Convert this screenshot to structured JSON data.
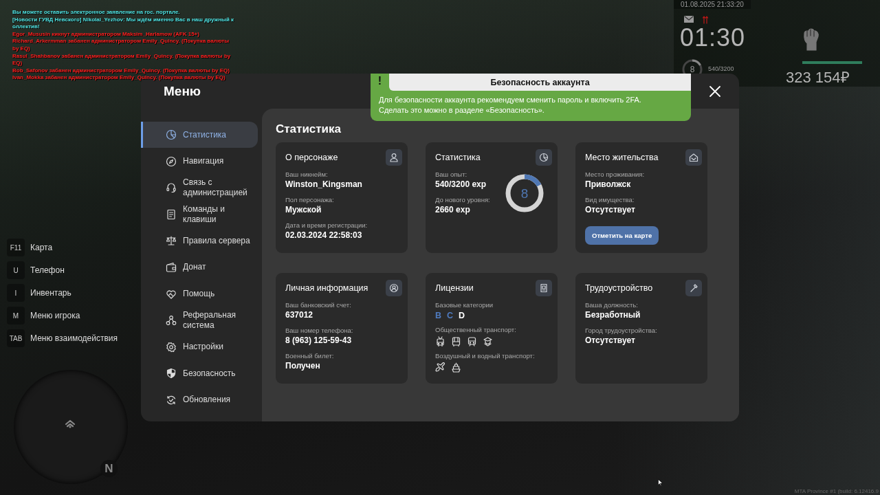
{
  "chat": [
    {
      "text": "Вы можете оставить электронное заявление на гос. портале.",
      "color": "#4fe3e3"
    },
    {
      "text": "[Новости ГУВД Невского] Nikolai_Yezhov: Мы ждём именно Вас в наш дружный к",
      "color": "#4fe3e3"
    },
    {
      "text": "оллектив!",
      "color": "#4fe3e3"
    },
    {
      "text": "Egor_Mususin кикнут администратором Maksim_Harlamow (AFK 15+)",
      "color": "#ff1e1e"
    },
    {
      "text": "Richard_Arkermman забанен администратором Emily_Quincy. (Покупка валюты",
      "color": "#ff1e1e"
    },
    {
      "text": "by EQ)",
      "color": "#ff1e1e"
    },
    {
      "text": "Rasul_Shahbanov забанен администратором Emily_Quincy. (Покупка валюты by",
      "color": "#ff1e1e"
    },
    {
      "text": "EQ)",
      "color": "#ff1e1e"
    },
    {
      "text": "Bob_Safonov забанен администратором Emily_Quincy. (Покупка валюты by EQ)",
      "color": "#ff1e1e"
    },
    {
      "text": "Ivan_Mokka забанен администратором Emily_Quincy. (Покупка валюты by EQ)",
      "color": "#ff1e1e"
    }
  ],
  "hud": {
    "datetime": "01.08.2025 21:33:20",
    "time": "01:30",
    "level_ring": {
      "value": "8",
      "level": 0.17
    },
    "xp": "540/3200",
    "meter": {
      "level": 1
    },
    "money": "323 154₽"
  },
  "key_hints": [
    {
      "key": "F11",
      "label": "Карта"
    },
    {
      "key": "U",
      "label": "Телефон"
    },
    {
      "key": "I",
      "label": "Инвентарь"
    },
    {
      "key": "M",
      "label": "Меню игрока"
    },
    {
      "key": "TAB",
      "label": "Меню взаимодействия"
    }
  ],
  "minimap": {
    "compass": "N"
  },
  "menu": {
    "title": "Меню",
    "sidebar": {
      "items": [
        {
          "label": "Статистика",
          "selected": true
        },
        {
          "label": "Навигация",
          "selected": false
        },
        {
          "label": "Связь с администрацией",
          "selected": false
        },
        {
          "label": "Команды и клавиши",
          "selected": false
        },
        {
          "label": "Правила сервера",
          "selected": false
        },
        {
          "label": "Донат",
          "selected": false
        },
        {
          "label": "Помощь",
          "selected": false
        },
        {
          "label": "Реферальная система",
          "selected": false
        },
        {
          "label": "Настройки",
          "selected": false
        },
        {
          "label": "Безопасность",
          "selected": false
        },
        {
          "label": "Обновления",
          "selected": false
        }
      ]
    },
    "content": {
      "title": "Статистика",
      "cards": [
        {
          "kind": "info",
          "title": "О персонаже",
          "fields": [
            {
              "label": "Ваш никнейм:",
              "value": "Winston_Kingsman"
            },
            {
              "label": "Пол персонажа:",
              "value": "Мужской"
            },
            {
              "label": "Дата и время регистрации:",
              "value": "02.03.2024 22:58:03"
            }
          ]
        },
        {
          "kind": "stats",
          "title": "Статистика",
          "fields": [
            {
              "label": "Ваш опыт:",
              "value": "540/3200 exp"
            },
            {
              "label": "До нового уровня:",
              "value": "2660 exp"
            }
          ],
          "ring": {
            "value": "8",
            "level": 0.17
          }
        },
        {
          "kind": "info",
          "title": "Место жительства",
          "fields": [
            {
              "label": "Место проживания:",
              "value": "Приволжск"
            },
            {
              "label": "Вид имущества:",
              "value": "Отсутствует"
            }
          ],
          "button": "Отметить на карте"
        },
        {
          "kind": "info",
          "title": "Личная информация",
          "fields": [
            {
              "label": "Ваш банковский счет:",
              "value": "637012"
            },
            {
              "label": "Ваш номер телефона:",
              "value": "8 (963) 125-59-43"
            },
            {
              "label": "Военный билет:",
              "value": "Получен"
            }
          ]
        },
        {
          "kind": "licenses",
          "title": "Лицензии",
          "groups": [
            {
              "label": "Базовые категории",
              "categories": [
                {
                  "letter": "B",
                  "obtained": true
                },
                {
                  "letter": "C",
                  "obtained": true
                },
                {
                  "letter": "D",
                  "obtained": false
                }
              ]
            },
            {
              "label": "Общественный транспорт:"
            },
            {
              "label": "Воздушный и водный транспорт:"
            }
          ]
        },
        {
          "kind": "info",
          "title": "Трудоустройство",
          "fields": [
            {
              "label": "Ваша должность:",
              "value": "Безработный"
            },
            {
              "label": "Город трудоустройства:",
              "value": "Отсутствует"
            }
          ]
        }
      ]
    }
  },
  "notification": {
    "mark": "!",
    "title": "Безопасность аккаунта",
    "text": "Для безопасности аккаунта рекомендуем сменить пароль и включить 2FA. Сделать это можно в разделе «Безопасность»."
  },
  "footer": "MTA Province #1 (build: 6.12416.9"
}
